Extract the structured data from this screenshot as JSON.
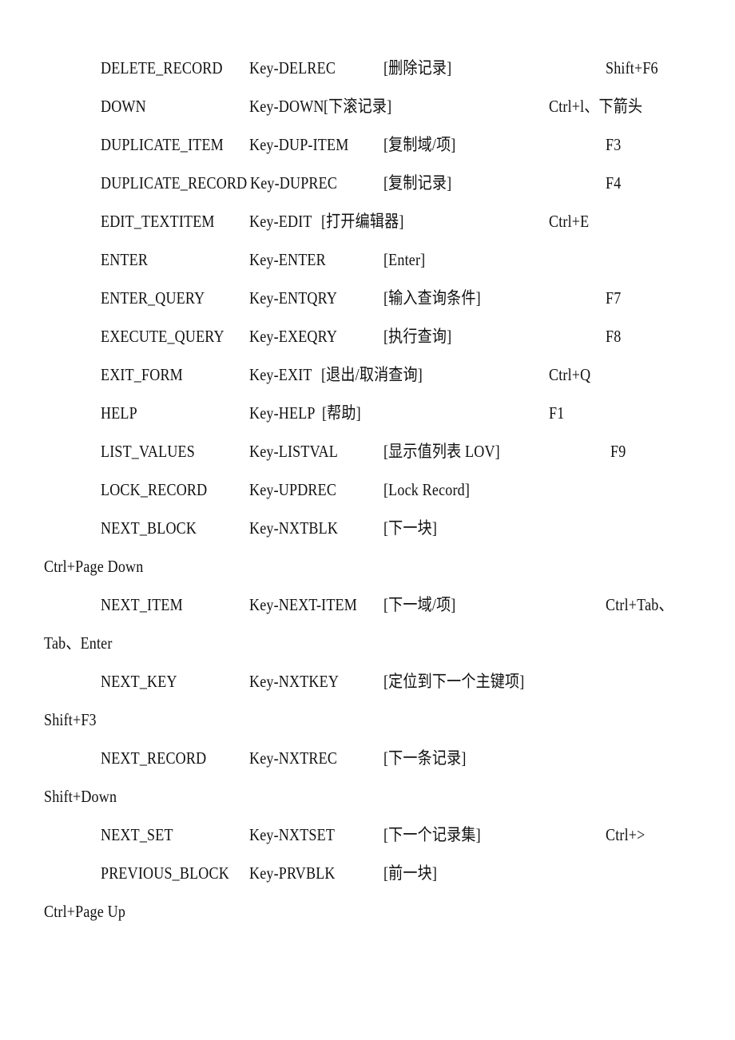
{
  "document": {
    "rows": [
      {
        "name": "DELETE_RECORD",
        "key": "Key-DELREC",
        "desc": "[删除记录]",
        "shortcut": "Shift+F6"
      },
      {
        "name": "DOWN",
        "key": "Key-DOWN",
        "desc": "[下滚记录]",
        "shortcut": "Ctrl+l、下箭头"
      },
      {
        "name": "DUPLICATE_ITEM",
        "key": "Key-DUP-ITEM",
        "desc": "[复制域/项]",
        "shortcut": "F3"
      },
      {
        "name": "DUPLICATE_RECORD",
        "key": "Key-DUPREC",
        "desc": "[复制记录]",
        "shortcut": "F4"
      },
      {
        "name": "EDIT_TEXTITEM",
        "key": "Key-EDIT",
        "desc": "[打开编辑器]",
        "shortcut": "Ctrl+E"
      },
      {
        "name": "ENTER",
        "key": "Key-ENTER",
        "desc": "[Enter]",
        "shortcut": ""
      },
      {
        "name": "ENTER_QUERY",
        "key": "Key-ENTQRY",
        "desc": "[输入查询条件]",
        "shortcut": "F7"
      },
      {
        "name": "EXECUTE_QUERY",
        "key": "Key-EXEQRY",
        "desc": "[执行查询]",
        "shortcut": "F8"
      },
      {
        "name": "EXIT_FORM",
        "key": "Key-EXIT",
        "desc": "[退出/取消查询]",
        "shortcut": "Ctrl+Q"
      },
      {
        "name": "HELP",
        "key": "Key-HELP",
        "desc": "[帮助]",
        "shortcut": "F1"
      },
      {
        "name": "LIST_VALUES",
        "key": "Key-LISTVAL",
        "desc": "[显示值列表 LOV]",
        "shortcut": "F9"
      },
      {
        "name": "LOCK_RECORD",
        "key": "Key-UPDREC",
        "desc": "[Lock Record]",
        "shortcut": ""
      },
      {
        "name": "NEXT_BLOCK",
        "key": "Key-NXTBLK",
        "desc": "[下一块]",
        "shortcut": "",
        "wrapped_shortcut": "Ctrl+Page Down"
      },
      {
        "name": "NEXT_ITEM",
        "key": "Key-NEXT-ITEM",
        "desc": "[下一域/项]",
        "shortcut": "Ctrl+Tab、",
        "wrapped_shortcut": "Tab、Enter"
      },
      {
        "name": "NEXT_KEY",
        "key": "Key-NXTKEY",
        "desc": "[定位到下一个主键项]",
        "shortcut": "",
        "wrapped_shortcut": "Shift+F3"
      },
      {
        "name": "NEXT_RECORD",
        "key": "Key-NXTREC",
        "desc": "[下一条记录]",
        "shortcut": "",
        "wrapped_shortcut": "Shift+Down"
      },
      {
        "name": "NEXT_SET",
        "key": "Key-NXTSET",
        "desc": "[下一个记录集]",
        "shortcut": "Ctrl+>"
      },
      {
        "name": "PREVIOUS_BLOCK",
        "key": "Key-PRVBLK",
        "desc": "[前一块]",
        "shortcut": "",
        "wrapped_shortcut": "Ctrl+Page Up"
      }
    ]
  }
}
